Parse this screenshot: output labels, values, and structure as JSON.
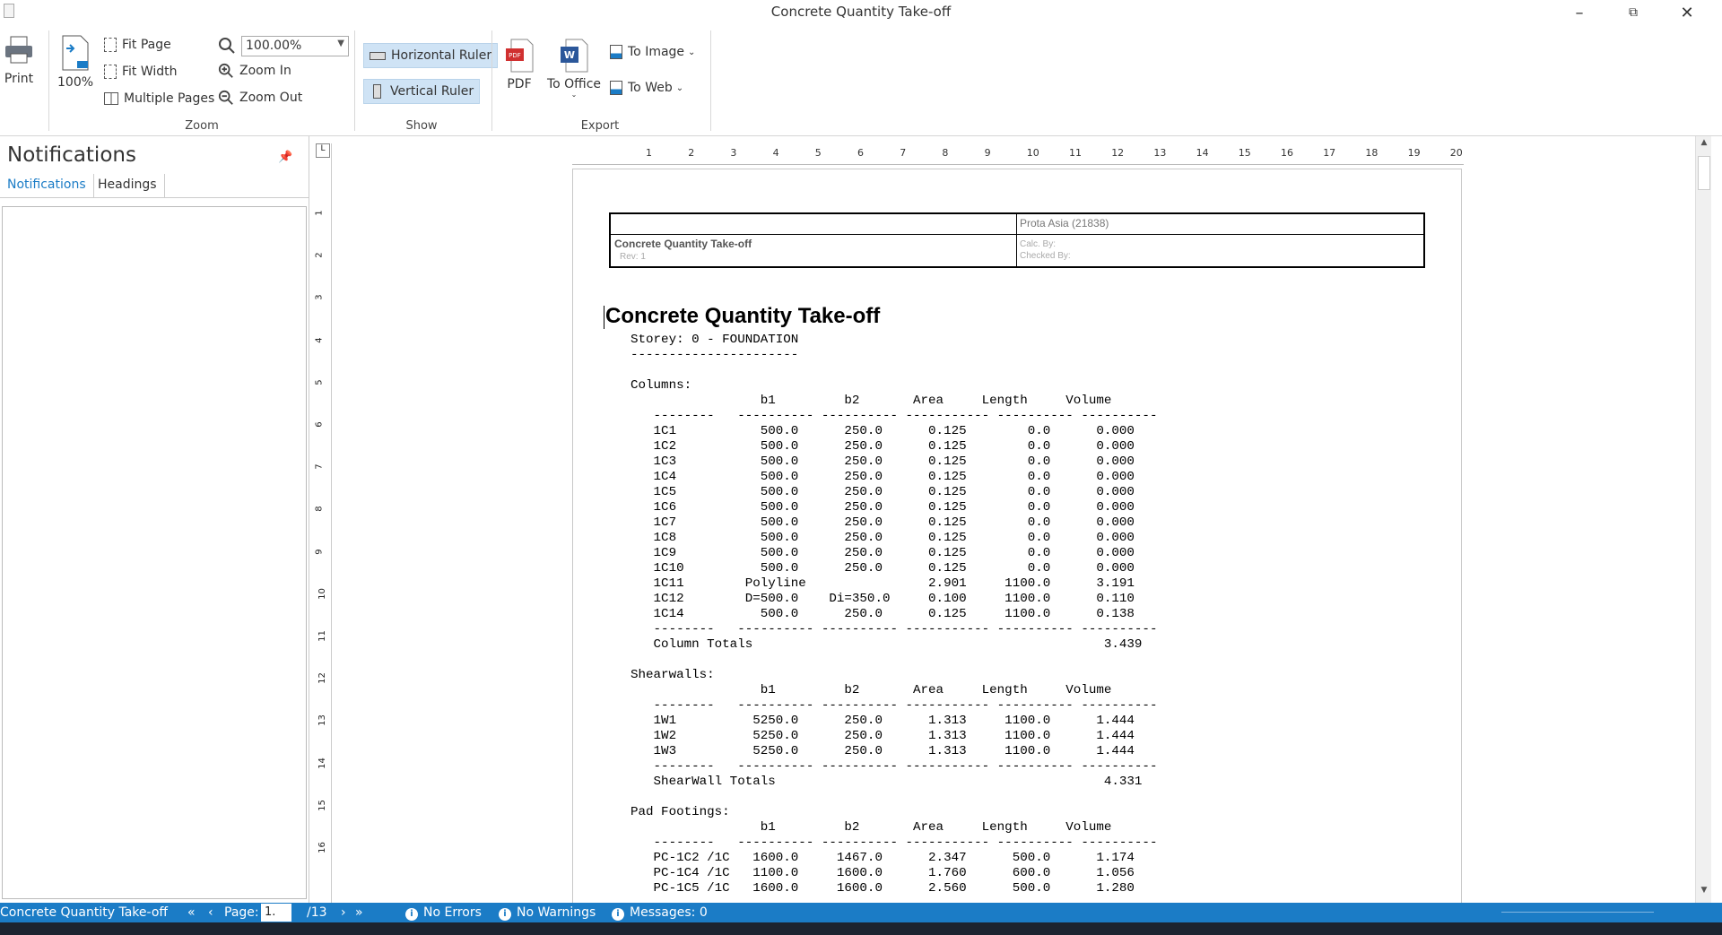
{
  "window": {
    "title": "Concrete Quantity Take-off"
  },
  "ribbon": {
    "print": "Print",
    "zoom100": "100%",
    "fit_page": "Fit Page",
    "fit_width": "Fit Width",
    "multiple_pages": "Multiple Pages",
    "zoom_value": "100.00%",
    "zoom_in": "Zoom In",
    "zoom_out": "Zoom Out",
    "group_zoom": "Zoom",
    "horizontal_ruler": "Horizontal Ruler",
    "vertical_ruler": "Vertical Ruler",
    "group_show": "Show",
    "pdf": "PDF",
    "to_office": "To Office",
    "to_image": "To Image",
    "to_web": "To Web",
    "group_export": "Export"
  },
  "panel": {
    "title": "Notifications",
    "tabs": [
      "Notifications",
      "Headings"
    ]
  },
  "ruler": {
    "h_numbers": [
      "1",
      "2",
      "3",
      "4",
      "5",
      "6",
      "7",
      "8",
      "9",
      "10",
      "11",
      "12",
      "13",
      "14",
      "15",
      "16",
      "17",
      "18",
      "19",
      "20"
    ],
    "v_numbers": [
      "1",
      "2",
      "3",
      "4",
      "5",
      "6",
      "7",
      "8",
      "9",
      "10",
      "11",
      "12",
      "13",
      "14",
      "15",
      "16"
    ]
  },
  "header_table": {
    "company": "Prota Asia (21838)",
    "doc": "Concrete Quantity Take-off",
    "rev": "Rev: 1",
    "calc_by": "Calc. By:",
    "checked_by": "Checked By:"
  },
  "document": {
    "title": "Concrete Quantity Take-off",
    "body": "Storey: 0 - FOUNDATION\n----------------------\n\nColumns:\n                 b1         b2       Area     Length     Volume\n   --------   ---------- ---------- ----------- ---------- ----------\n   1C1           500.0      250.0      0.125        0.0      0.000\n   1C2           500.0      250.0      0.125        0.0      0.000\n   1C3           500.0      250.0      0.125        0.0      0.000\n   1C4           500.0      250.0      0.125        0.0      0.000\n   1C5           500.0      250.0      0.125        0.0      0.000\n   1C6           500.0      250.0      0.125        0.0      0.000\n   1C7           500.0      250.0      0.125        0.0      0.000\n   1C8           500.0      250.0      0.125        0.0      0.000\n   1C9           500.0      250.0      0.125        0.0      0.000\n   1C10          500.0      250.0      0.125        0.0      0.000\n   1C11        Polyline                2.901     1100.0      3.191\n   1C12        D=500.0    Di=350.0     0.100     1100.0      0.110\n   1C14          500.0      250.0      0.125     1100.0      0.138\n   --------   ---------- ---------- ----------- ---------- ----------\n   Column Totals                                              3.439\n\nShearwalls:\n                 b1         b2       Area     Length     Volume\n   --------   ---------- ---------- ----------- ---------- ----------\n   1W1          5250.0      250.0      1.313     1100.0      1.444\n   1W2          5250.0      250.0      1.313     1100.0      1.444\n   1W3          5250.0      250.0      1.313     1100.0      1.444\n   --------   ---------- ---------- ----------- ---------- ----------\n   ShearWall Totals                                           4.331\n\nPad Footings:\n                 b1         b2       Area     Length     Volume\n   --------   ---------- ---------- ----------- ---------- ----------\n   PC-1C2 /1C   1600.0     1467.0      2.347      500.0      1.174\n   PC-1C4 /1C   1100.0     1600.0      1.760      600.0      1.056\n   PC-1C5 /1C   1600.0     1600.0      2.560      500.0      1.280"
  },
  "status": {
    "doc_name": "Concrete Quantity Take-off",
    "page_label": "Page:",
    "page_current": "1.",
    "page_total": "/13",
    "errors": "No Errors",
    "warnings": "No Warnings",
    "messages": "Messages: 0"
  }
}
